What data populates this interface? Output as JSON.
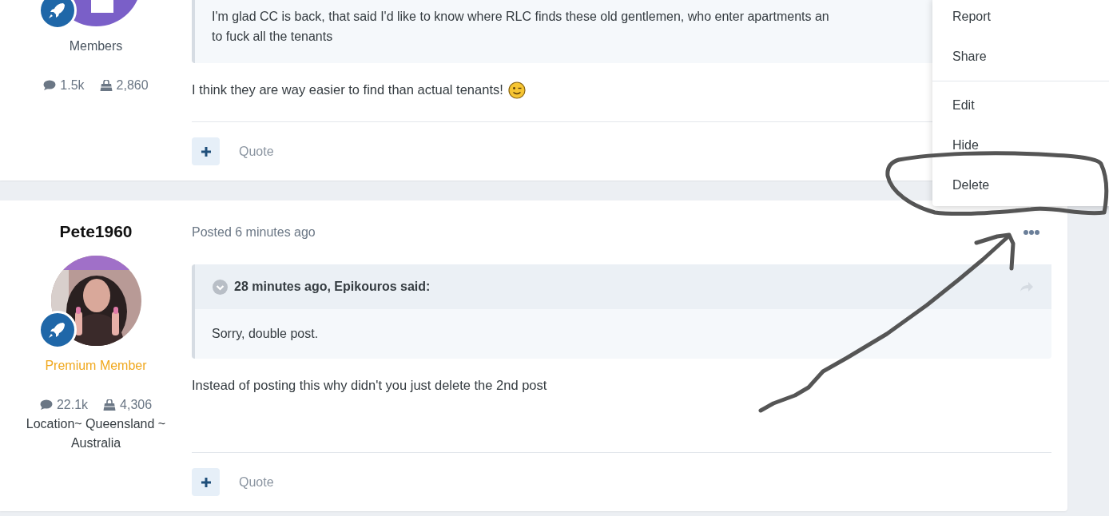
{
  "posts": [
    {
      "author": {
        "group": {
          "label": "Members",
          "color": "#4a5560"
        },
        "stats": {
          "posts": "1.5k",
          "reputation": "2,860"
        }
      },
      "quote": {
        "lines": [
          "I'm glad CC is back, that said I'd like to know where RLC finds these old gentlemen, who enter apartments an",
          "to fuck all the tenants"
        ]
      },
      "comment": "I think they are way easier to find than actual tenants!",
      "footer": {
        "quote_link": "Quote"
      }
    },
    {
      "author": {
        "name": "Pete1960",
        "group": {
          "label": "Premium Member",
          "color": "#f0a81e"
        },
        "stats": {
          "posts": "22.1k",
          "reputation": "4,306"
        },
        "location": "Location~ Queensland ~ Australia"
      },
      "posted": "Posted 6 minutes ago",
      "quote": {
        "citation": "28 minutes ago, Epikouros said:",
        "lines": [
          "Sorry, double post."
        ]
      },
      "comment": "Instead of posting this why didn't you just delete the 2nd post",
      "footer": {
        "quote_link": "Quote"
      }
    }
  ],
  "menu": {
    "groups": [
      [
        "Report",
        "Share"
      ],
      [
        "Edit",
        "Hide",
        "Delete"
      ]
    ]
  }
}
